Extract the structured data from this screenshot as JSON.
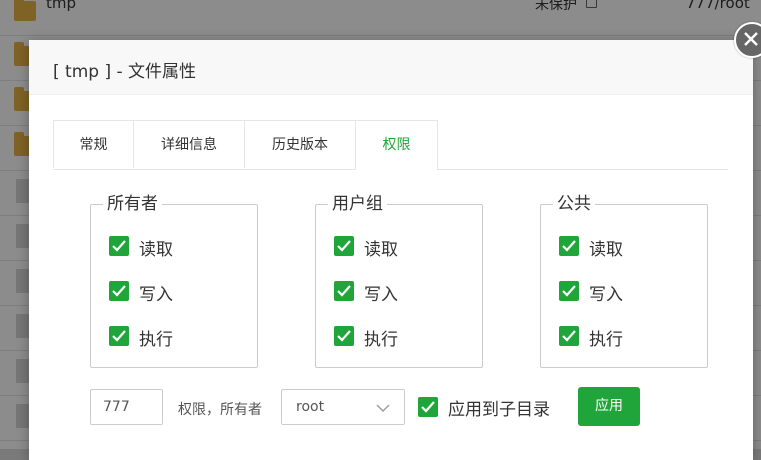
{
  "background": {
    "rows": [
      {
        "name": "tmp",
        "status": "未保护",
        "perm": "777/root",
        "type": "folder"
      },
      {
        "name": "",
        "status": "",
        "perm": "",
        "type": "folder"
      },
      {
        "name": "",
        "status": "",
        "perm": "",
        "type": "folder"
      },
      {
        "name": "",
        "status": "",
        "perm": "",
        "type": "folder"
      },
      {
        "name": "",
        "status": "",
        "perm": "",
        "type": "file"
      },
      {
        "name": "",
        "status": "",
        "perm": "",
        "type": "file"
      },
      {
        "name": "",
        "status": "",
        "perm": "",
        "type": "file"
      },
      {
        "name": "",
        "status": "",
        "perm": "",
        "type": "file"
      },
      {
        "name": "",
        "status": "",
        "perm": "",
        "type": "file"
      },
      {
        "name": "",
        "status": "",
        "perm": "",
        "type": "file"
      }
    ]
  },
  "dialog": {
    "title": "[ tmp ] - 文件属性",
    "close_icon": "close-icon",
    "tabs": [
      {
        "label": "常规",
        "active": false
      },
      {
        "label": "详细信息",
        "active": false
      },
      {
        "label": "历史版本",
        "active": false
      },
      {
        "label": "权限",
        "active": true
      }
    ],
    "groups": [
      {
        "title": "所有者",
        "items": [
          {
            "label": "读取",
            "checked": true
          },
          {
            "label": "写入",
            "checked": true
          },
          {
            "label": "执行",
            "checked": true
          }
        ]
      },
      {
        "title": "用户组",
        "items": [
          {
            "label": "读取",
            "checked": true
          },
          {
            "label": "写入",
            "checked": true
          },
          {
            "label": "执行",
            "checked": true
          }
        ]
      },
      {
        "title": "公共",
        "items": [
          {
            "label": "读取",
            "checked": true
          },
          {
            "label": "写入",
            "checked": true
          },
          {
            "label": "执行",
            "checked": true
          }
        ]
      }
    ],
    "perm_value": "777",
    "perm_caption": "权限，所有者",
    "owner_selected": "root",
    "apply_subdirs_label": "应用到子目录",
    "apply_subdirs_checked": true,
    "apply_button": "应用"
  },
  "colors": {
    "accent": "#20a53a",
    "folder": "#e8b545"
  }
}
